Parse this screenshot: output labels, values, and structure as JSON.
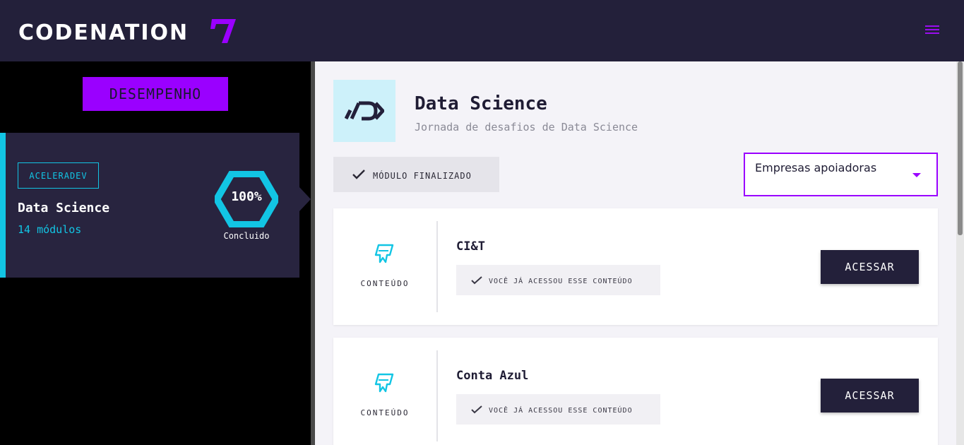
{
  "header": {
    "logo_text": "CODENATION",
    "menu_icon": "hamburger-menu-icon",
    "accent_color": "#9a00ff"
  },
  "sidebar": {
    "performance_button": "DESEMPENHO",
    "course": {
      "badge": "ACELERADEV",
      "title": "Data Science",
      "modules": "14 módulos",
      "progress_percent": "100%",
      "progress_value": 1.0,
      "progress_label": "Concluido",
      "accent_color": "#12c5e4"
    }
  },
  "module": {
    "title": "Data Science",
    "subtitle": "Jornada de desafios de Data Science",
    "status": "MÓDULO FINALIZADO",
    "filter": {
      "selected": "Empresas apoiadoras"
    }
  },
  "contents": [
    {
      "type_label": "CONTEÚDO",
      "name": "CI&T",
      "status": "VOCÊ JÁ ACESSOU ESSE CONTEÚDO",
      "action": "ACESSAR"
    },
    {
      "type_label": "CONTEÚDO",
      "name": "Conta Azul",
      "status": "VOCÊ JÁ ACESSOU ESSE CONTEÚDO",
      "action": "ACESSAR"
    }
  ]
}
